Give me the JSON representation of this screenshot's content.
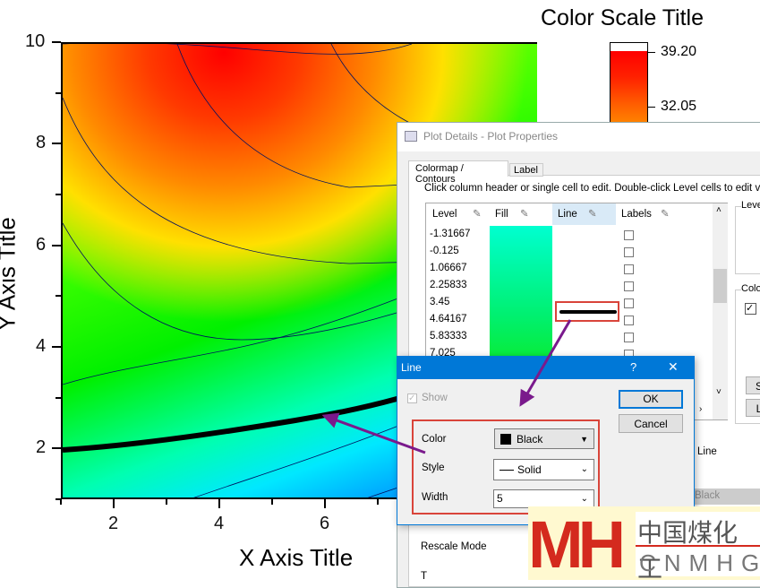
{
  "chart_data": {
    "type": "heatmap",
    "xlabel": "X Axis Title",
    "ylabel": "Y Axis Title",
    "xlim": [
      1,
      10
    ],
    "ylim": [
      1,
      10
    ],
    "xticks": [
      "2",
      "4",
      "6"
    ],
    "yticks": [
      "2",
      "4",
      "6",
      "8",
      "10"
    ],
    "colorscale": {
      "title": "Color Scale Title",
      "labels": [
        "39.20",
        "32.05"
      ]
    },
    "highlighted_contour": {
      "level": 3.45,
      "color": "#000000",
      "width": 5
    }
  },
  "plot_details": {
    "title": "Plot Details - Plot Properties",
    "tabs": [
      "Colormap / Contours",
      "Label"
    ],
    "hint": "Click column header or single cell to edit. Double-click Level cells to edit values.",
    "columns": [
      "Level",
      "Fill",
      "Line",
      "Labels"
    ],
    "levels": [
      "-1.31667",
      "-0.125",
      "1.06667",
      "2.25833",
      "3.45",
      "4.64167",
      "5.83333",
      "7.025"
    ],
    "right_groups": [
      "Leve",
      "Colo"
    ],
    "right_buttons": [
      "S",
      "L"
    ],
    "line_label": "Line",
    "black_label": "Black",
    "rescale_label": "Rescale Mode",
    "bottom_label": "T"
  },
  "line_dialog": {
    "title": "Line",
    "help": "?",
    "close": "✕",
    "show_label": "Show",
    "ok": "OK",
    "cancel": "Cancel",
    "color_label": "Color",
    "color_value": "Black",
    "style_label": "Style",
    "style_value": "Solid",
    "width_label": "Width",
    "width_value": "5"
  },
  "watermark": {
    "logo": "MH",
    "cn": "中国煤化工",
    "en": "CNMHG"
  },
  "colors": {
    "accent": "#0078d7",
    "highlight": "#d9443a",
    "arrow": "#7a1a8c"
  }
}
